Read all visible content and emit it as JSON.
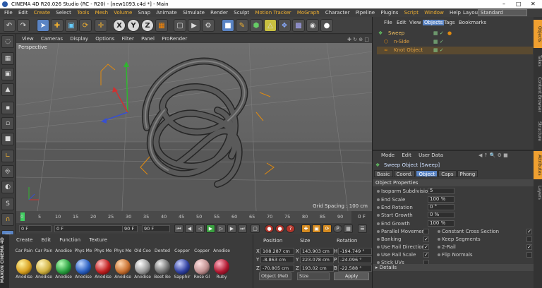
{
  "window": {
    "title": "CINEMA 4D R20.026 Studio (RC - R20) - [new1093.c4d *] - Main"
  },
  "menubar": {
    "items": [
      "File",
      "Edit",
      "Create",
      "Select",
      "Tools",
      "Mesh",
      "Volume",
      "Snap",
      "Animate",
      "Simulate",
      "Render",
      "Sculpt",
      "Motion Tracker",
      "MoGraph",
      "Character",
      "Pipeline",
      "Plugins",
      "Script",
      "Window",
      "Help"
    ],
    "layout_label": "Layout:",
    "layout_value": "Standard"
  },
  "viewport": {
    "menu": [
      "View",
      "Cameras",
      "Display",
      "Options",
      "Filter",
      "Panel",
      "ProRender"
    ],
    "label": "Perspective",
    "grid_spacing": "Grid Spacing : 100 cm"
  },
  "timeline": {
    "ticks": [
      "0",
      "5",
      "10",
      "15",
      "20",
      "25",
      "30",
      "35",
      "40",
      "45",
      "50",
      "55",
      "60",
      "65",
      "70",
      "75",
      "80",
      "85",
      "90"
    ],
    "end_label": "0 F"
  },
  "transport": {
    "start_field": "0 F",
    "current_field": "0 F",
    "end_field": "90 F",
    "max_field": "90 F"
  },
  "materials": {
    "menu": [
      "Create",
      "Edit",
      "Function",
      "Texture"
    ],
    "row1": [
      {
        "label": "Car Pain",
        "color": "#d8a020"
      },
      {
        "label": "Car Pain",
        "color": "#c0c0c0"
      },
      {
        "label": "Anodise",
        "color": "#2aa040"
      },
      {
        "label": "Phys Me",
        "color": "#2a5fc0"
      },
      {
        "label": "Phys Me",
        "color": "#c02020"
      },
      {
        "label": "Phys Me",
        "color": "#c87030"
      },
      {
        "label": "Old Coo",
        "color": "#cfcfcf"
      },
      {
        "label": "Dented",
        "color": "#909090"
      },
      {
        "label": "Copper",
        "color": "#d07a30"
      },
      {
        "label": "Copper",
        "color": "#8a8a8a"
      },
      {
        "label": "Anodise",
        "color": "#c8c8d0"
      }
    ],
    "row2_labels": [
      "Anodise",
      "Anodise",
      "Anodise",
      "Anodise",
      "Anodise",
      "Anodise",
      "Anodise",
      "Beet Bo",
      "Sapphir",
      "Rose Gl",
      "Ruby"
    ]
  },
  "coordinates": {
    "headers": [
      "Position",
      "Size",
      "Rotation"
    ],
    "rows": [
      {
        "axis": "X",
        "pos": "108.287 cm",
        "size_axis": "X",
        "size": "143.903 cm",
        "rot_axis": "H",
        "rot": "-194.749 °"
      },
      {
        "axis": "Y",
        "pos": "-8.863 cm",
        "size_axis": "Y",
        "size": "223.078 cm",
        "rot_axis": "P",
        "rot": "-24.096 °"
      },
      {
        "axis": "Z",
        "pos": "-70.805 cm",
        "size_axis": "Z",
        "size": "193.02 cm",
        "rot_axis": "B",
        "rot": "-22.588 °"
      }
    ],
    "mode": "Object (Rel)",
    "size_mode": "Size",
    "apply": "Apply"
  },
  "object_manager": {
    "menu": [
      "File",
      "Edit",
      "View",
      "Objects",
      "Tags",
      "Bookmarks"
    ],
    "active_menu": "Objects",
    "objects": [
      {
        "name": "Sweep",
        "color": "#f0c060"
      },
      {
        "name": "n-Side",
        "color": "#e0a040"
      },
      {
        "name": "Knot Object",
        "color": "#e0a040"
      }
    ]
  },
  "attributes": {
    "menu": [
      "Mode",
      "Edit",
      "User Data"
    ],
    "title": "Sweep Object [Sweep]",
    "tabs": [
      "Basic",
      "Coord.",
      "Object",
      "Caps",
      "Phong"
    ],
    "active_tab": "Object",
    "section": "Object Properties",
    "props": [
      {
        "label": "Isoparm Subdivision",
        "value": "5"
      },
      {
        "label": "End Scale",
        "value": "100 %"
      },
      {
        "label": "End Rotation",
        "value": "0 °"
      },
      {
        "label": "Start Growth",
        "value": "0 %"
      },
      {
        "label": "End Growth",
        "value": "100 %"
      }
    ],
    "checks_left": [
      {
        "label": "Parallel Movement",
        "checked": false
      },
      {
        "label": "Banking",
        "checked": true
      },
      {
        "label": "Use Rail Direction",
        "checked": true
      },
      {
        "label": "Use Rail Scale",
        "checked": true
      },
      {
        "label": "Stick UVs",
        "checked": false
      }
    ],
    "checks_right": [
      {
        "label": "Constant Cross Section",
        "checked": true
      },
      {
        "label": "Keep Segments",
        "checked": false
      },
      {
        "label": "2-Rail",
        "checked": true
      },
      {
        "label": "Flip Normals",
        "checked": false
      }
    ],
    "details": "Details"
  },
  "side_tabs": [
    "Objects",
    "Takes",
    "Content Browser",
    "Structure",
    "Attributes",
    "Layers"
  ]
}
